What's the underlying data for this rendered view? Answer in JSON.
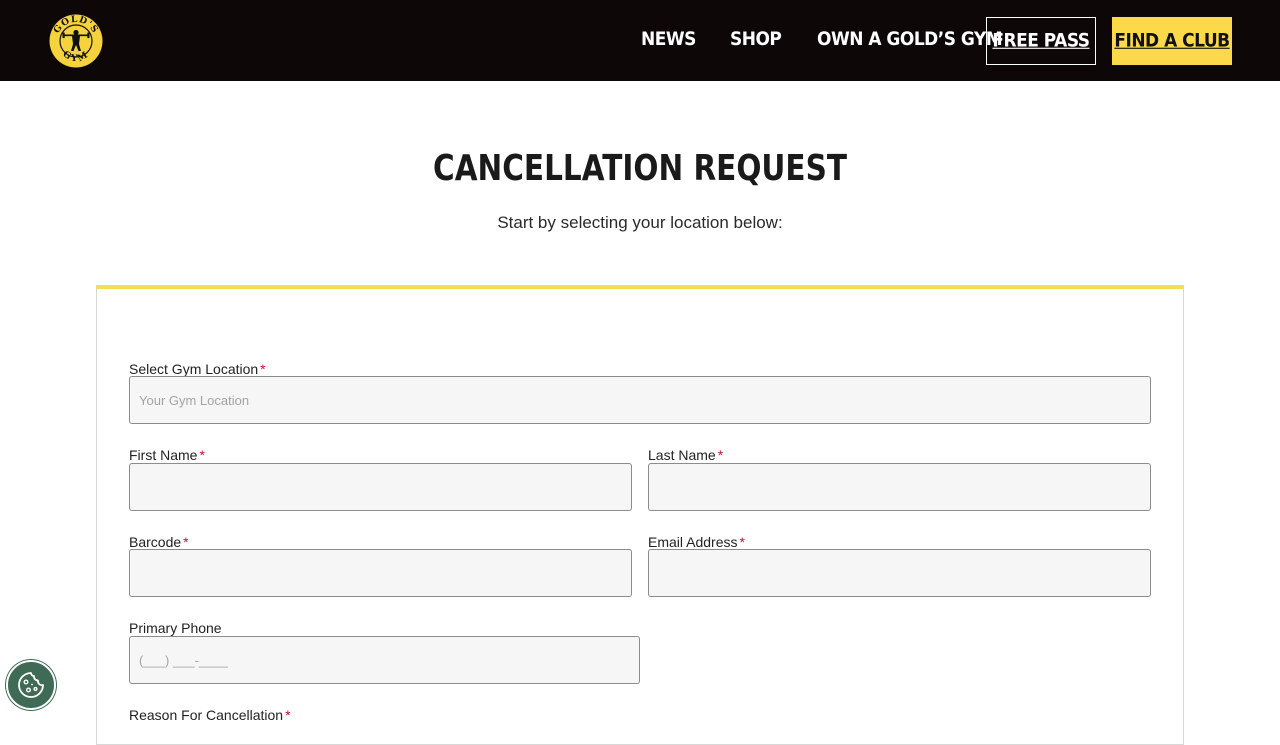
{
  "header": {
    "logo_text_top": "GOLD'S",
    "logo_text_bottom": "GYM",
    "nav": [
      {
        "label": "NEWS"
      },
      {
        "label": "SHOP"
      },
      {
        "label": "OWN A GOLD’S GYM"
      }
    ],
    "free_pass_label": "FREE PASS",
    "find_club_label": "FIND A CLUB",
    "colors": {
      "background": "#0d0708",
      "accent": "#fbd94a"
    }
  },
  "page": {
    "title": "CANCELLATION REQUEST",
    "subtitle": "Start by selecting your location below:"
  },
  "form": {
    "required_marker": "*",
    "fields": {
      "gym_location": {
        "label": "Select Gym Location",
        "placeholder": "Your Gym Location",
        "value": ""
      },
      "first_name": {
        "label": "First Name",
        "placeholder": "",
        "value": ""
      },
      "last_name": {
        "label": "Last Name",
        "placeholder": "",
        "value": ""
      },
      "barcode": {
        "label": "Barcode",
        "placeholder": "",
        "value": ""
      },
      "email": {
        "label": "Email Address",
        "placeholder": "",
        "value": ""
      },
      "phone": {
        "label": "Primary Phone",
        "placeholder": "(___) ___-____",
        "value": ""
      },
      "reason": {
        "label": "Reason For Cancellation"
      }
    },
    "colors": {
      "card_border_top": "#f1df4e",
      "required": "#c8102e"
    }
  },
  "cookie": {
    "icon": "cookie-icon",
    "color": "#3f6b56"
  }
}
